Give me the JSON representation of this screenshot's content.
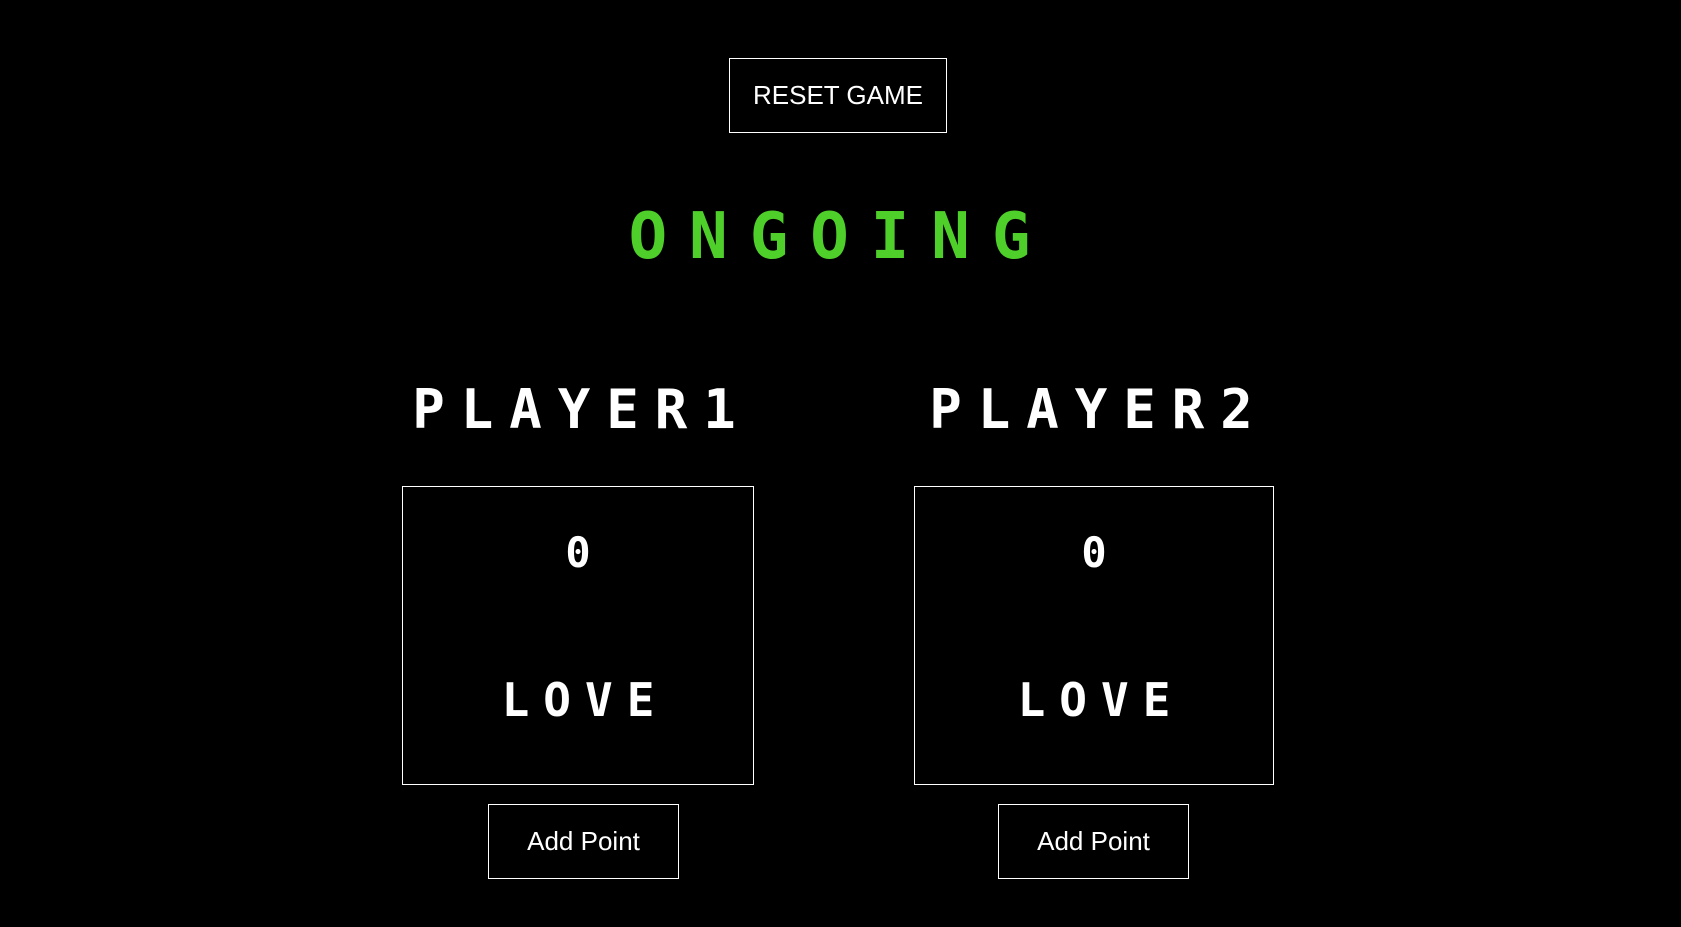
{
  "toolbar": {
    "reset_label": "RESET GAME"
  },
  "game": {
    "status": "ONGOING",
    "status_color": "#4fcf2a"
  },
  "players": [
    {
      "name": "PLAYER1",
      "score": "0",
      "score_word": "LOVE",
      "add_label": "Add Point"
    },
    {
      "name": "PLAYER2",
      "score": "0",
      "score_word": "LOVE",
      "add_label": "Add Point"
    }
  ],
  "colors": {
    "background": "#000000",
    "foreground": "#ffffff",
    "accent": "#4fcf2a"
  }
}
